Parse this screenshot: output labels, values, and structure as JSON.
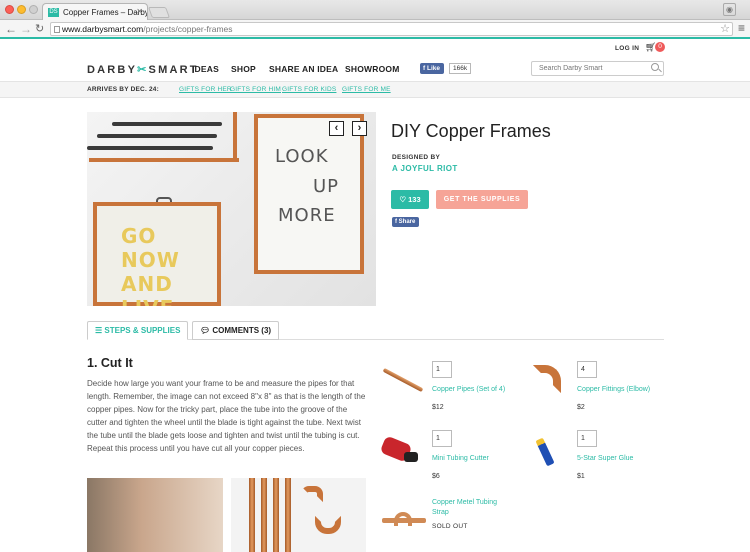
{
  "browser": {
    "tab_title": "Copper Frames – Darby Sm",
    "tab_favicon": "DS",
    "url_host": "www.darbysmart.com",
    "url_path": "/projects/copper-frames"
  },
  "header": {
    "login": "LOG IN",
    "cart_count": "0",
    "logo_left": "DARBY",
    "logo_right": "SMART",
    "nav": [
      "IDEAS",
      "SHOP",
      "SHARE AN IDEA",
      "SHOWROOM"
    ],
    "fb_like": "Like",
    "fb_count": "166k",
    "search_placeholder": "Search Darby Smart"
  },
  "giftbar": {
    "arrives": "ARRIVES BY DEC. 24:",
    "links": [
      "GIFTS FOR HER",
      "GIFTS FOR HIM",
      "GIFTS FOR KIDS",
      "GIFTS FOR ME"
    ]
  },
  "hero": {
    "text_left": "GO NOW AND LIVE",
    "text_right": [
      "LOOK",
      "UP",
      "MORE"
    ]
  },
  "project": {
    "title": "DIY Copper Frames",
    "designed_by": "DESIGNED BY",
    "designer": "A JOYFUL RIOT",
    "like_count": "133",
    "supplies_button": "GET THE SUPPLIES",
    "share": "Share"
  },
  "tabs": {
    "steps": "STEPS & SUPPLIES",
    "comments": "COMMENTS (3)"
  },
  "step": {
    "title": "1. Cut It",
    "body": "Decide how large you want your frame to be and measure the pipes for that length. Remember, the image can not exceed 8\"x 8\" as that is the length of the copper pipes. Now for the tricky part, place the tube into the groove of the cutter and tighten the wheel until the blade is tight against the tube. Next twist the tube until the blade gets loose and tighten and twist until the tubing is cut. Repeat this process until you have cut all your copper pieces."
  },
  "supplies": [
    {
      "name": "Copper Pipes (Set of 4)",
      "qty": "1",
      "price": "$12"
    },
    {
      "name": "Copper Fittings (Elbow)",
      "qty": "4",
      "price": "$2"
    },
    {
      "name": "Mini Tubing Cutter",
      "qty": "1",
      "price": "$6"
    },
    {
      "name": "5-Star Super Glue",
      "qty": "1",
      "price": "$1"
    },
    {
      "name": "Copper Metel Tubing Strap",
      "qty": "",
      "price": "SOLD OUT"
    }
  ],
  "colors": {
    "accent": "#2cbba6",
    "cta": "#f6a497",
    "facebook": "#4a66a0"
  }
}
